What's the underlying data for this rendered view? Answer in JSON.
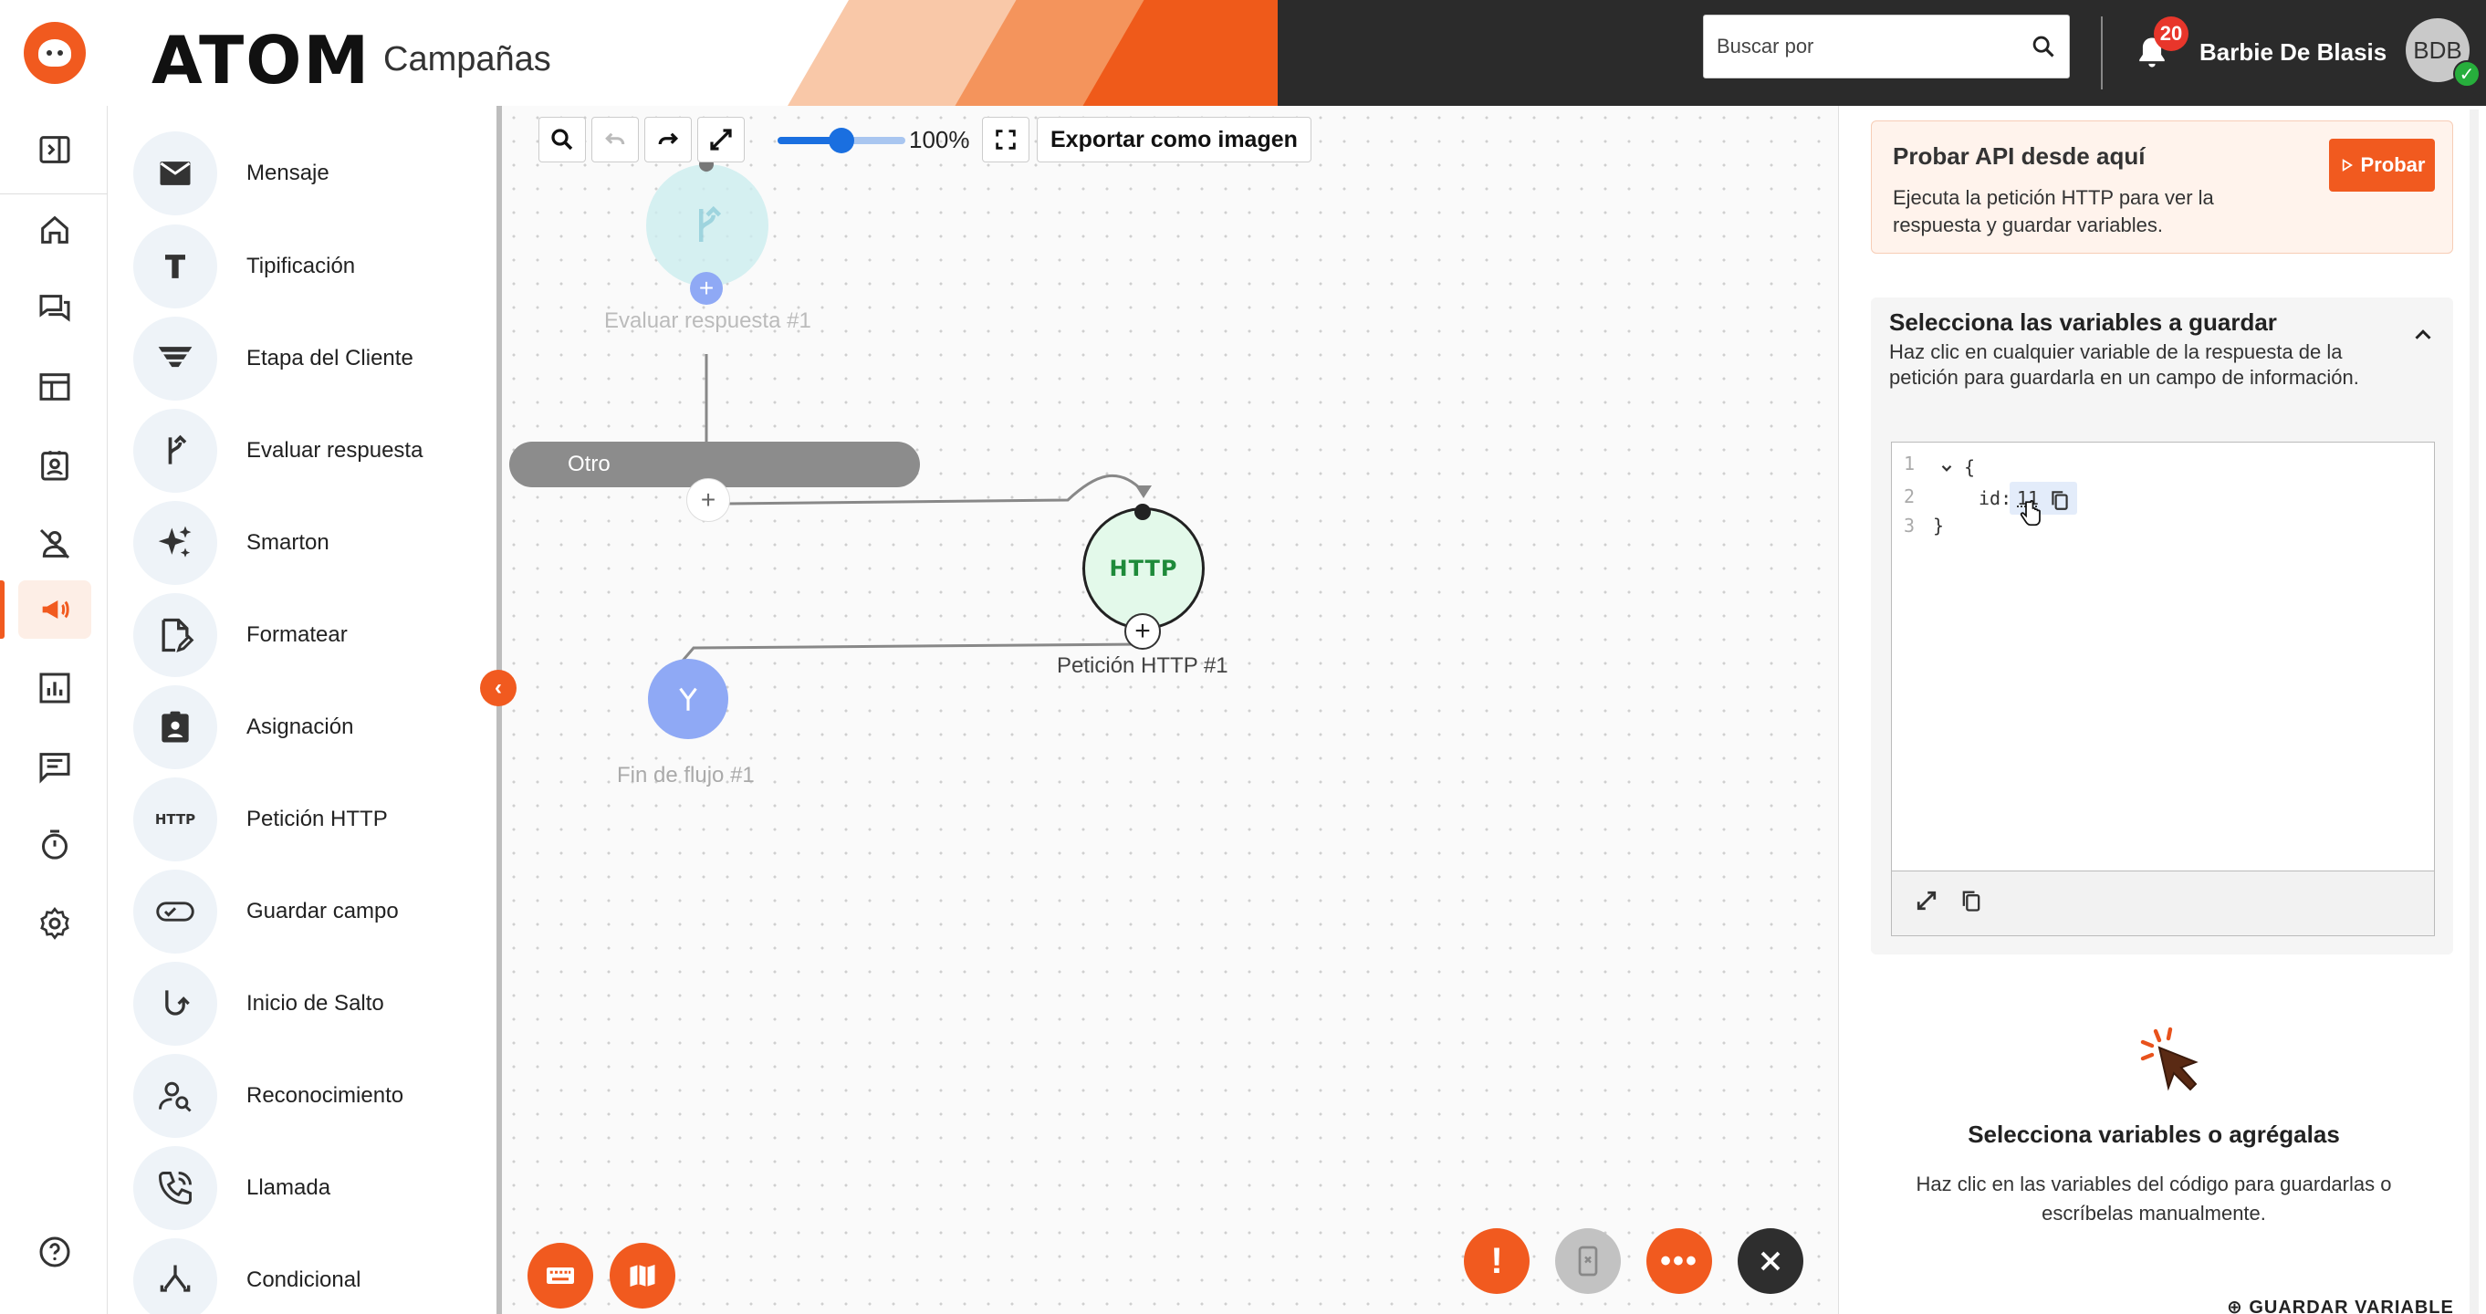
{
  "header": {
    "brand": "ATOM",
    "section": "Campañas",
    "search_placeholder": "Buscar por",
    "notifications_count": "20",
    "user_name": "Barbie De Blasis",
    "avatar_initials": "BDB"
  },
  "palette": {
    "items": [
      {
        "label": "Mensaje",
        "icon": "envelope-icon"
      },
      {
        "label": "Tipificación",
        "icon": "text-t-icon"
      },
      {
        "label": "Etapa del Cliente",
        "icon": "funnel-icon"
      },
      {
        "label": "Evaluar respuesta",
        "icon": "branch-icon"
      },
      {
        "label": "Smarton",
        "icon": "sparkle-icon"
      },
      {
        "label": "Formatear",
        "icon": "file-edit-icon"
      },
      {
        "label": "Asignación",
        "icon": "assignment-icon"
      },
      {
        "label": "Petición HTTP",
        "icon": "http-icon"
      },
      {
        "label": "Guardar campo",
        "icon": "toggle-field-icon"
      },
      {
        "label": "Inicio de Salto",
        "icon": "jump-icon"
      },
      {
        "label": "Reconocimiento",
        "icon": "person-search-icon"
      },
      {
        "label": "Llamada",
        "icon": "phone-icon"
      },
      {
        "label": "Condicional",
        "icon": "fork-icon"
      }
    ]
  },
  "toolbar": {
    "zoom_label": "100%",
    "zoom_level": 0.5,
    "export_label": "Exportar como imagen"
  },
  "canvas": {
    "node_evaluar": "Evaluar respuesta #1",
    "branch_otro": "Otro",
    "node_http_badge": "HTTP",
    "node_http": "Petición HTTP #1",
    "node_fin": "Fin de flujo #1"
  },
  "right_panel": {
    "api_title": "Probar API desde aquí",
    "api_desc": "Ejecuta la petición HTTP para ver la respuesta y guardar variables.",
    "probar_label": "Probar",
    "vars_title": "Selecciona las variables a guardar",
    "vars_desc": "Haz clic en cualquier variable de la respuesta de la petición para guardarla en un campo de información.",
    "code": {
      "line_numbers": [
        "1",
        "2",
        "3"
      ],
      "open_brace": "{",
      "key": "id:",
      "value": "11",
      "close_brace": "}"
    },
    "empty_title": "Selecciona variables o agrégalas",
    "empty_desc": "Haz clic en las variables del código para guardarlas o escríbelas manualmente.",
    "guardar_label": "GUARDAR VARIABLE"
  },
  "colors": {
    "accent": "#f15a1f",
    "header_dark": "#2b2b2b",
    "http_node_fill": "#e3f9ea",
    "fin_node_fill": "#8fa9f5"
  }
}
